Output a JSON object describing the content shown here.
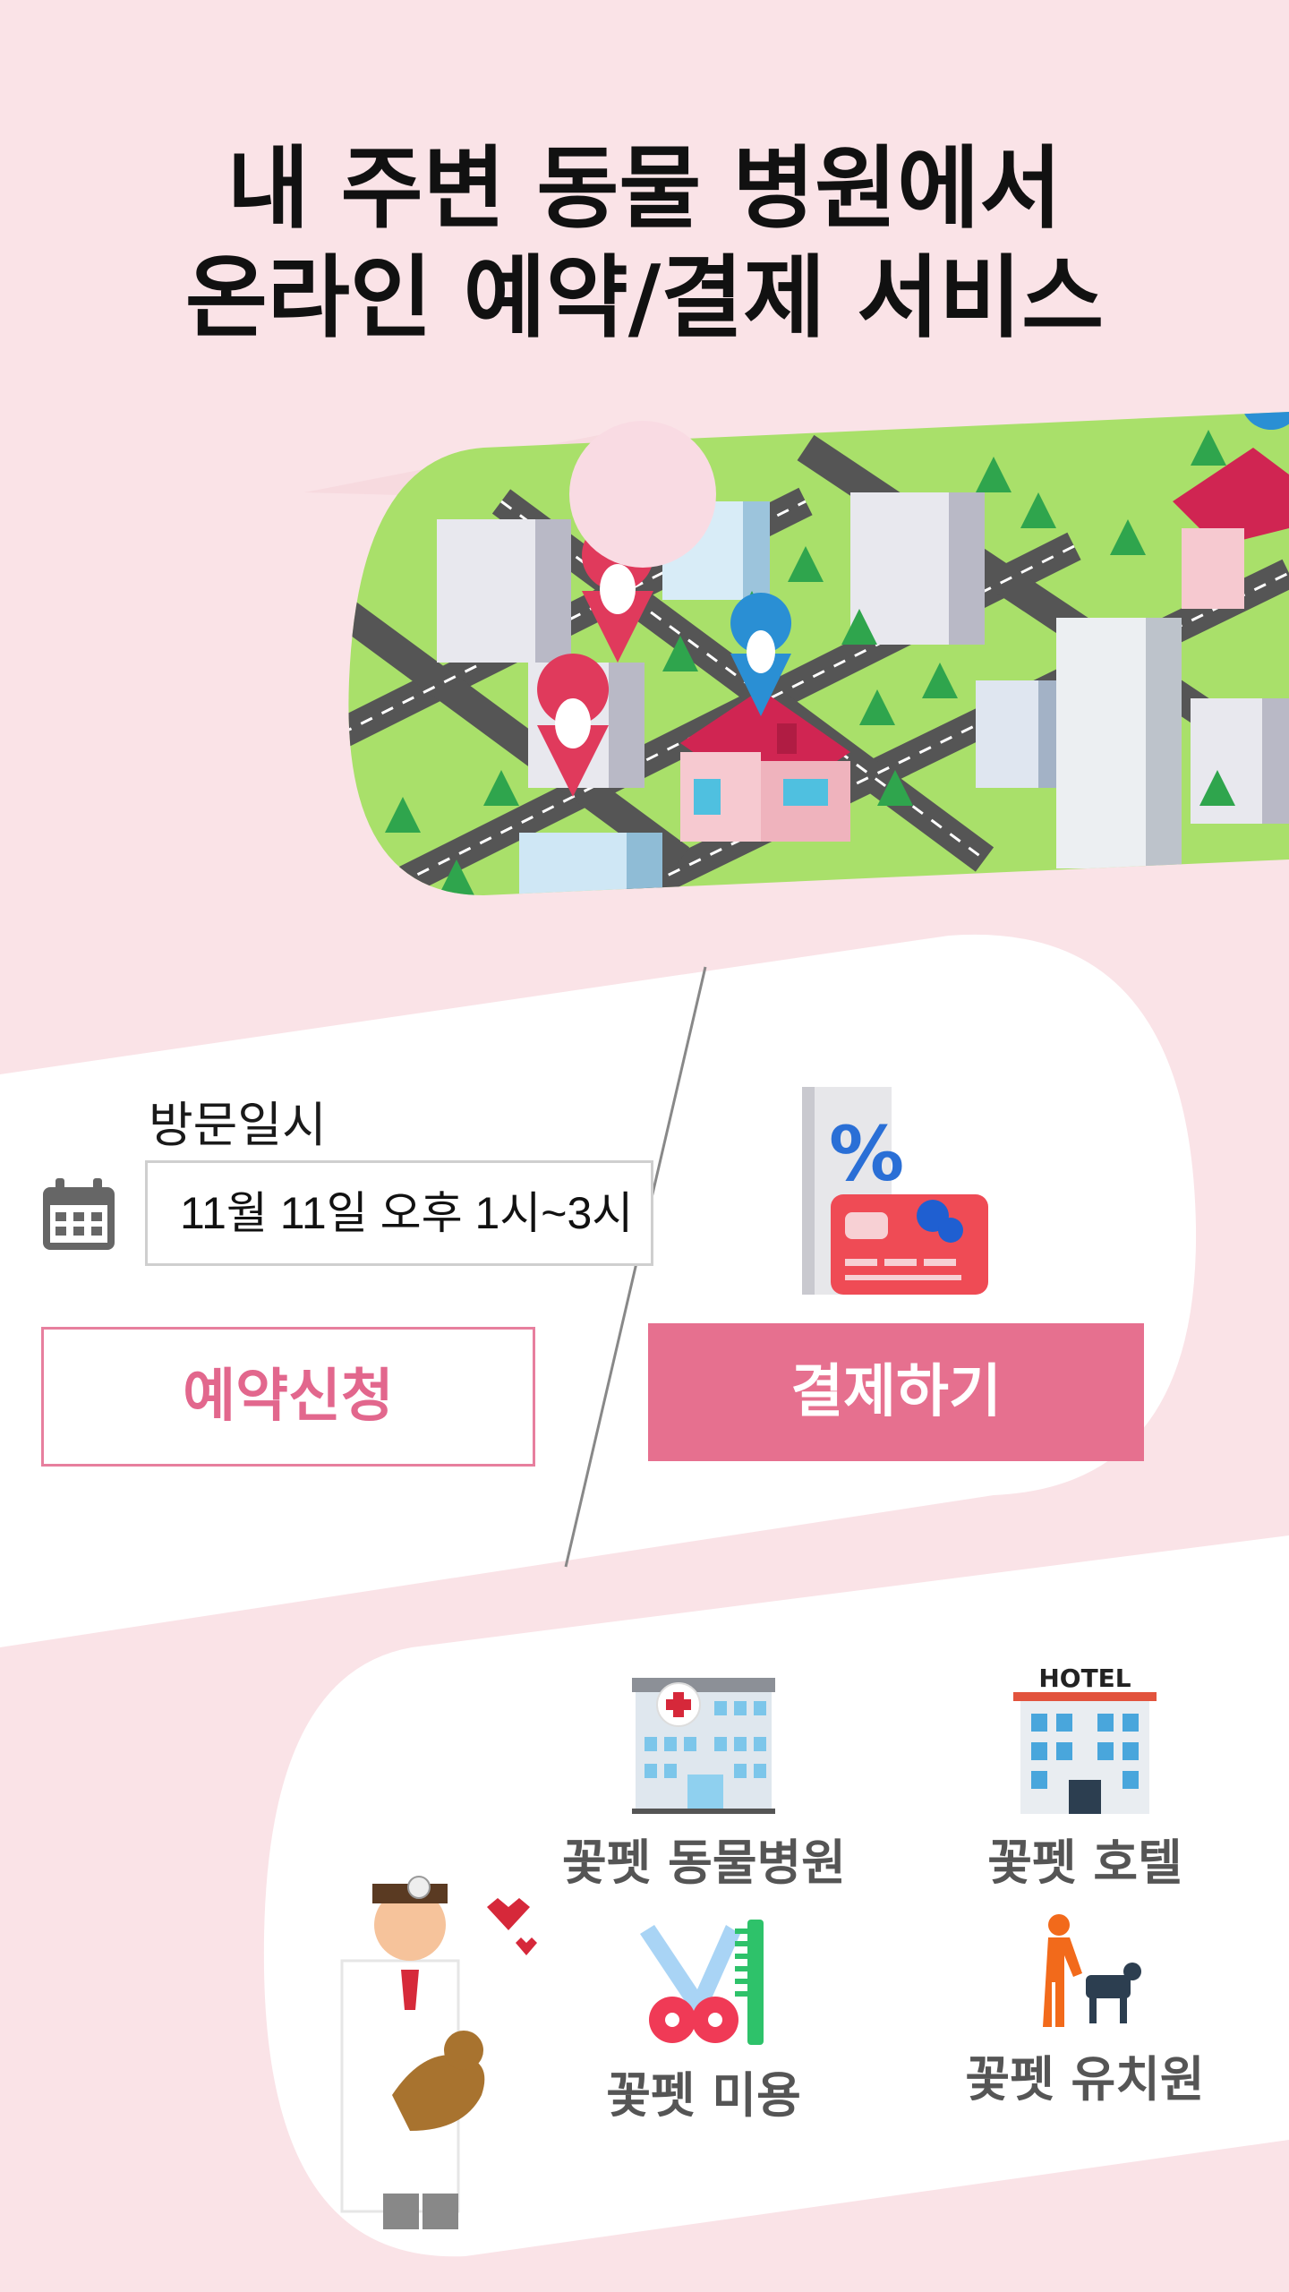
{
  "headline": {
    "line1": "내 주변 동물 병원에서",
    "line2": "온라인 예약/결제 서비스"
  },
  "booking": {
    "visit_label": "방문일시",
    "date_value": "11월 11일 오후 1시~3시",
    "reserve_button": "예약신청",
    "pay_button": "결제하기",
    "discount_symbol": "%"
  },
  "services": [
    {
      "label": "꽃펫 동물병원",
      "icon": "hospital-icon"
    },
    {
      "label": "꽃펫 호텔",
      "icon": "hotel-icon",
      "sign": "HOTEL"
    },
    {
      "label": "꽃펫 미용",
      "icon": "grooming-icon"
    },
    {
      "label": "꽃펫 유치원",
      "icon": "kindergarten-icon"
    }
  ],
  "colors": {
    "background": "#fae3e7",
    "accent": "#e6708f",
    "reserve_text": "#e2678d"
  }
}
